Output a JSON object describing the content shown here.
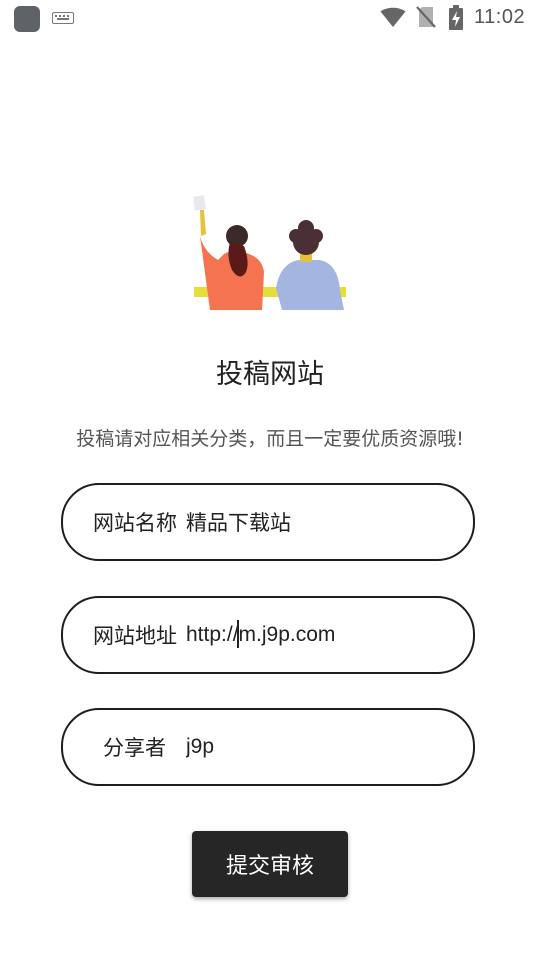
{
  "status_bar": {
    "time": "11:02",
    "icons": [
      "app-icon",
      "keyboard-icon",
      "wifi-icon",
      "no-sim-icon",
      "battery-charging-icon"
    ]
  },
  "illustration": {
    "name": "two-people-submission-illustration"
  },
  "page": {
    "title": "投稿网站",
    "subtitle": "投稿请对应相关分类，而且一定要优质资源哦!"
  },
  "form": {
    "site_name": {
      "label": "网站名称",
      "value": "精品下载站"
    },
    "site_url": {
      "label": "网站地址",
      "value": "http://m.j9p.com"
    },
    "sharer": {
      "label": "分享者",
      "value": "j9p"
    }
  },
  "actions": {
    "submit_label": "提交审核"
  },
  "colors": {
    "button_bg": "#262626",
    "field_border": "#1e1e1e",
    "person_left_shirt": "#f47452",
    "person_right_shirt": "#a3b5e0",
    "desk": "#e6dd3b"
  }
}
